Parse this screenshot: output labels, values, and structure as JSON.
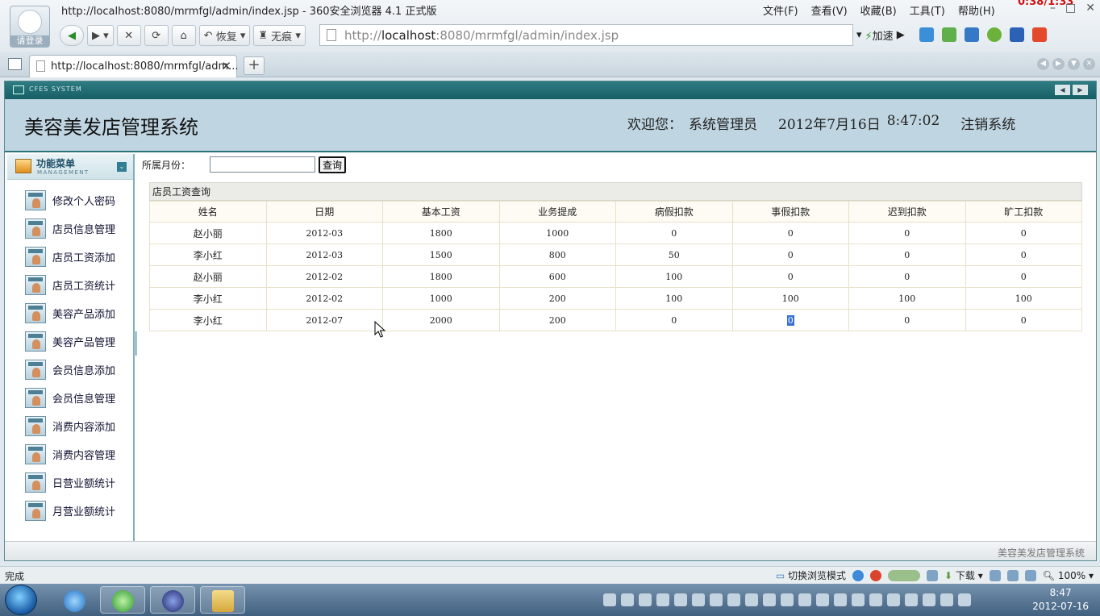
{
  "browser": {
    "window_title": "http://localhost:8080/mrmfgl/admin/index.jsp - 360安全浏览器 4.1 正式版",
    "login_label": "请登录",
    "menu": [
      "文件(F)",
      "查看(V)",
      "收藏(B)",
      "工具(T)",
      "帮助(H)"
    ],
    "timer": "0:38/1:33",
    "nav": {
      "restore": "恢复",
      "no_trace": "无痕"
    },
    "address_prefix": "http://",
    "address_host": "localhost",
    "address_rest": ":8080/mrmfgl/admin/index.jsp",
    "speed_label": "加速",
    "tab_title": "http://localhost:8080/mrmfgl/adm...",
    "status_text": "完成",
    "switch_mode": "切换浏览模式",
    "download": "下载",
    "zoom": "100%"
  },
  "app": {
    "system_bar_label": "CFES SYSTEM",
    "title": "美容美发店管理系统",
    "welcome": "欢迎您：",
    "user": "系统管理员",
    "date": "2012年7月16日",
    "time": "8:47:02",
    "logout": "注销系统",
    "footer": "美容美发店管理系统"
  },
  "sidebar": {
    "title": "功能菜单",
    "subtitle": "MANAGEMENT",
    "items": [
      "修改个人密码",
      "店员信息管理",
      "店员工资添加",
      "店员工资统计",
      "美容产品添加",
      "美容产品管理",
      "会员信息添加",
      "会员信息管理",
      "消费内容添加",
      "消费内容管理",
      "日营业额统计",
      "月营业额统计"
    ]
  },
  "query": {
    "label": "所属月份：",
    "value": "",
    "button": "查询"
  },
  "table": {
    "caption": "店员工资查询",
    "headers": [
      "姓名",
      "日期",
      "基本工资",
      "业务提成",
      "病假扣款",
      "事假扣款",
      "迟到扣款",
      "旷工扣款"
    ],
    "rows": [
      [
        "赵小丽",
        "2012-03",
        "1800",
        "1000",
        "0",
        "0",
        "0",
        "0"
      ],
      [
        "李小红",
        "2012-03",
        "1500",
        "800",
        "50",
        "0",
        "0",
        "0"
      ],
      [
        "赵小丽",
        "2012-02",
        "1800",
        "600",
        "100",
        "0",
        "0",
        "0"
      ],
      [
        "李小红",
        "2012-02",
        "1000",
        "200",
        "100",
        "100",
        "100",
        "100"
      ],
      [
        "李小红",
        "2012-07",
        "2000",
        "200",
        "0",
        "0",
        "0",
        "0"
      ]
    ]
  },
  "taskbar": {
    "clock_time": "8:47",
    "clock_date": "2012-07-16"
  }
}
